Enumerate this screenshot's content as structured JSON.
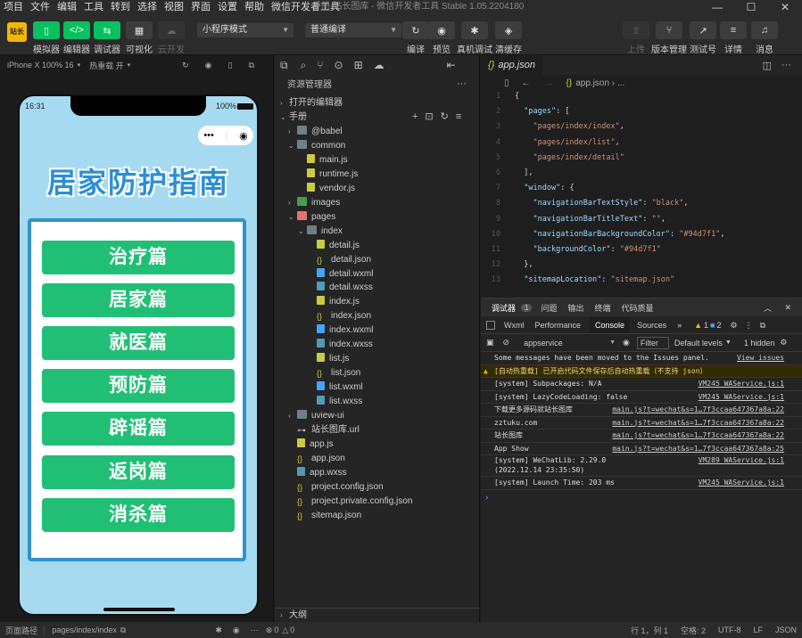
{
  "menu": [
    "项目",
    "文件",
    "编辑",
    "工具",
    "转到",
    "选择",
    "视图",
    "界面",
    "设置",
    "帮助",
    "微信开发者工具"
  ],
  "window_title": "手册-站长图库 - 微信开发者工具 Stable 1.05.2204180",
  "toolbar": {
    "brand": "站长",
    "left_buttons": [
      "模拟器",
      "编辑器",
      "调试器",
      "可视化",
      "云开发"
    ],
    "mode_select": "小程序模式",
    "compile_select": "普通编译",
    "action_buttons": [
      "编译",
      "预览",
      "真机调试",
      "清缓存"
    ],
    "right_buttons": [
      "上传",
      "版本管理",
      "测试号",
      "详情",
      "消息"
    ]
  },
  "simulator": {
    "device": "iPhone X 100% 16",
    "hot_reload": "热重载 开",
    "time": "16:31",
    "battery": "100%",
    "page_title": "居家防护指南",
    "buttons": [
      "治疗篇",
      "居家篇",
      "就医篇",
      "预防篇",
      "辟谣篇",
      "返岗篇",
      "消杀篇"
    ]
  },
  "explorer": {
    "header": "资源管理器",
    "open_editors": "打开的编辑器",
    "project": "手册",
    "tree": [
      {
        "name": "@babel",
        "type": "folder",
        "depth": 1,
        "open": false
      },
      {
        "name": "common",
        "type": "folder",
        "depth": 1,
        "open": true
      },
      {
        "name": "main.js",
        "type": "js",
        "depth": 2
      },
      {
        "name": "runtime.js",
        "type": "js",
        "depth": 2
      },
      {
        "name": "vendor.js",
        "type": "js",
        "depth": 2
      },
      {
        "name": "images",
        "type": "folder",
        "depth": 1,
        "open": false
      },
      {
        "name": "pages",
        "type": "folder",
        "depth": 1,
        "open": true
      },
      {
        "name": "index",
        "type": "folder",
        "depth": 2,
        "open": true
      },
      {
        "name": "detail.js",
        "type": "js",
        "depth": 3
      },
      {
        "name": "detail.json",
        "type": "json",
        "depth": 3
      },
      {
        "name": "detail.wxml",
        "type": "wxml",
        "depth": 3
      },
      {
        "name": "detail.wxss",
        "type": "wxss",
        "depth": 3
      },
      {
        "name": "index.js",
        "type": "js",
        "depth": 3
      },
      {
        "name": "index.json",
        "type": "json",
        "depth": 3
      },
      {
        "name": "index.wxml",
        "type": "wxml",
        "depth": 3
      },
      {
        "name": "index.wxss",
        "type": "wxss",
        "depth": 3
      },
      {
        "name": "list.js",
        "type": "js",
        "depth": 3
      },
      {
        "name": "list.json",
        "type": "json",
        "depth": 3
      },
      {
        "name": "list.wxml",
        "type": "wxml",
        "depth": 3
      },
      {
        "name": "list.wxss",
        "type": "wxss",
        "depth": 3
      },
      {
        "name": "uview-ui",
        "type": "folder",
        "depth": 1,
        "open": false
      },
      {
        "name": "站长图库.url",
        "type": "link",
        "depth": 1
      },
      {
        "name": "app.js",
        "type": "js",
        "depth": 1
      },
      {
        "name": "app.json",
        "type": "json",
        "depth": 1
      },
      {
        "name": "app.wxss",
        "type": "wxss",
        "depth": 1
      },
      {
        "name": "project.config.json",
        "type": "json",
        "depth": 1
      },
      {
        "name": "project.private.config.json",
        "type": "json",
        "depth": 1
      },
      {
        "name": "sitemap.json",
        "type": "json",
        "depth": 1
      }
    ],
    "outline": "大纲"
  },
  "editor": {
    "tab": "app.json",
    "breadcrumb": "app.json › ...",
    "lines": [
      {
        "n": "1",
        "t": "{"
      },
      {
        "n": "2",
        "t": "  \"pages\": ["
      },
      {
        "n": "3",
        "t": "    \"pages/index/index\","
      },
      {
        "n": "4",
        "t": "    \"pages/index/list\","
      },
      {
        "n": "5",
        "t": "    \"pages/index/detail\""
      },
      {
        "n": "6",
        "t": "  ],"
      },
      {
        "n": "7",
        "t": "  \"window\": {"
      },
      {
        "n": "8",
        "t": "    \"navigationBarTextStyle\": \"black\","
      },
      {
        "n": "9",
        "t": "    \"navigationBarTitleText\": \"\","
      },
      {
        "n": "10",
        "t": "    \"navigationBarBackgroundColor\": \"#94d7f1\","
      },
      {
        "n": "11",
        "t": "    \"backgroundColor\": \"#94d7f1\""
      },
      {
        "n": "12",
        "t": "  },"
      },
      {
        "n": "13",
        "t": "  \"sitemapLocation\": \"sitemap.json\""
      }
    ]
  },
  "console": {
    "panel_tabs": [
      "调试器",
      "1",
      "问题",
      "输出",
      "终端",
      "代码质量"
    ],
    "devtools_tabs": [
      "Wxml",
      "Performance",
      "Console",
      "Sources",
      "»"
    ],
    "warn_count": "1",
    "info_count": "2",
    "context": "appservice",
    "filter_placeholder": "Filter",
    "levels": "Default levels",
    "hidden": "1 hidden",
    "logs": [
      {
        "text": "Some messages have been moved to the Issues panel.",
        "src": "View issues",
        "kind": "info"
      },
      {
        "text": "[自动热重载] 已开启代码文件保存后自动热重载（不支持 json）",
        "src": "",
        "kind": "warn"
      },
      {
        "text": "[system] Subpackages: N/A",
        "src": "VM245 WAService.js:1",
        "kind": "log"
      },
      {
        "text": "[system] LazyCodeLoading: false",
        "src": "VM245 WAService.js:1",
        "kind": "log"
      },
      {
        "text": "下载更多源码就站长图库",
        "src": "main.js?t=wechat&s=1…7f3ccaa647367a8a:22",
        "kind": "log"
      },
      {
        "text": "zztuku.com",
        "src": "main.js?t=wechat&s=1…7f3ccaa647367a8a:22",
        "kind": "log"
      },
      {
        "text": "站长图库",
        "src": "main.js?t=wechat&s=1…7f3ccaa647367a8a:22",
        "kind": "log"
      },
      {
        "text": "App Show",
        "src": "main.js?t=wechat&s=1…7f3ccaa647367a8a:25",
        "kind": "log"
      },
      {
        "text": "[system] WeChatLib: 2.29.0 (2022.12.14 23:35:50)",
        "src": "VM289 WAService.js:1",
        "kind": "log"
      },
      {
        "text": "[system] Launch Time: 203 ms",
        "src": "VM245 WAService.js:1",
        "kind": "log"
      }
    ]
  },
  "status": {
    "page_path_label": "页面路径",
    "page_path": "pages/index/index",
    "errors": "0",
    "warnings": "0",
    "cursor": "行 1，列 1",
    "spaces": "空格: 2",
    "encoding": "UTF-8",
    "eol": "LF",
    "lang": "JSON"
  }
}
